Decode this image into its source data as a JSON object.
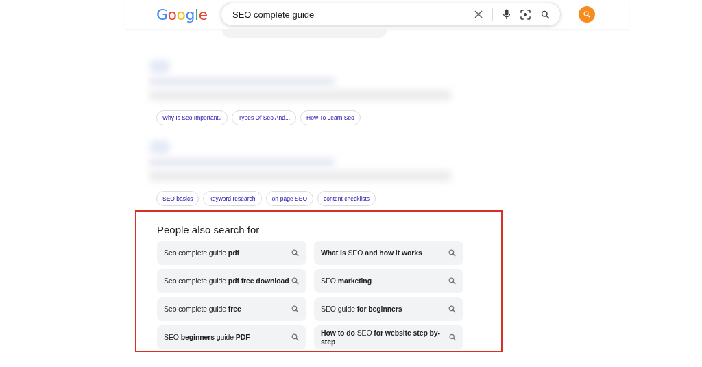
{
  "header": {
    "logo": "Google",
    "search": {
      "value": "SEO complete guide"
    }
  },
  "results": [
    {
      "chips": [
        "Why Is Seo Important?",
        "Types Of Seo And...",
        "How To Learn Seo"
      ]
    },
    {
      "chips": [
        "SEO basics",
        "keyword research",
        "on-page SEO",
        "content checklists"
      ]
    }
  ],
  "people_also_search": {
    "title": "People also search for",
    "items": [
      "Seo complete guide **pdf**",
      "**What is** SEO **and how it works**",
      "Seo complete guide **pdf free download**",
      "SEO **marketing**",
      "Seo complete guide **free**",
      "SEO guide **for beginners**",
      "SEO **beginners** guide **PDF**",
      "**How to do** SEO **for website step by-step**"
    ]
  }
}
